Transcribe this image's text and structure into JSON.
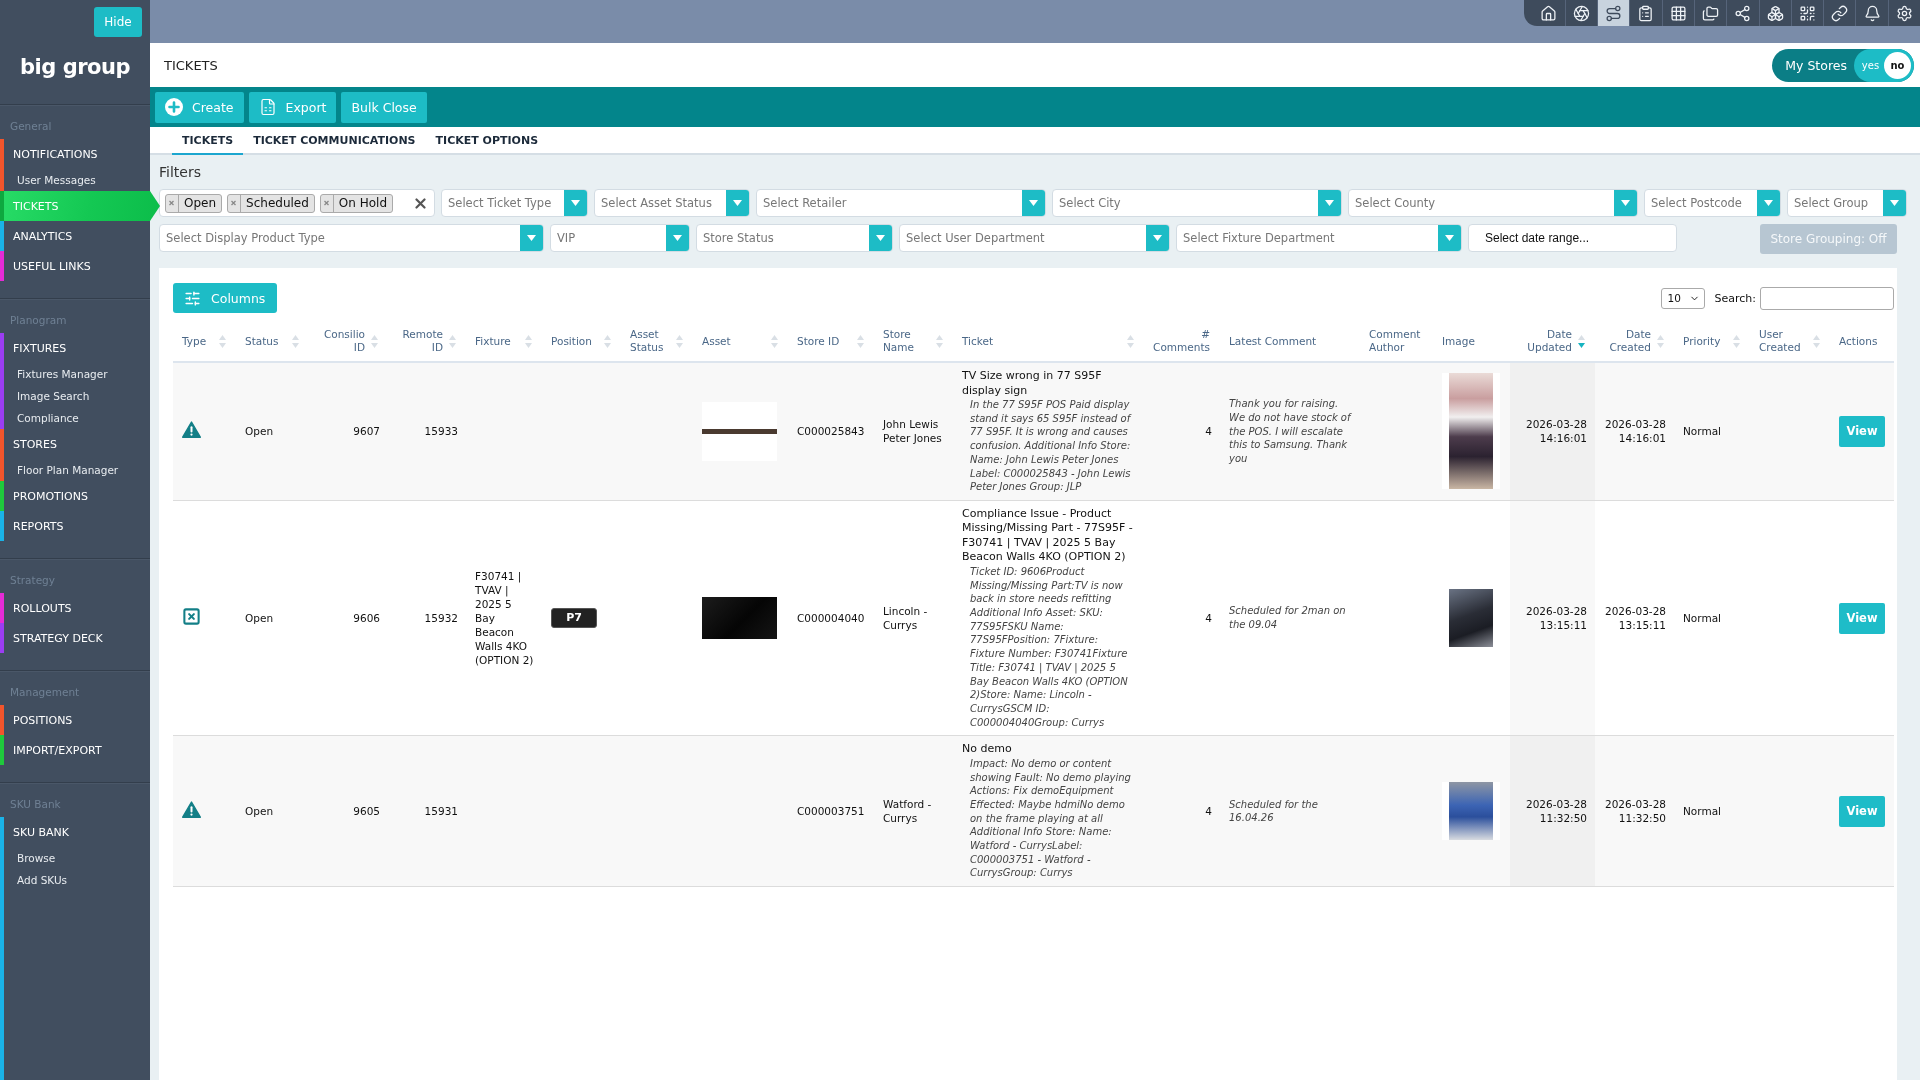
{
  "sidebar": {
    "hide_button": "Hide",
    "logo": "big group",
    "sections": [
      {
        "title": "General",
        "items": [
          {
            "label": "NOTIFICATIONS",
            "color": "#f2552c",
            "selected": false,
            "children": [
              {
                "label": "User Messages",
                "selected": false
              }
            ]
          },
          {
            "label": "TICKETS",
            "color": "#0ea83f",
            "selected": true
          },
          {
            "label": "ANALYTICS",
            "color": "#1ab3e8",
            "selected": false
          },
          {
            "label": "USEFUL LINKS",
            "color": "#e52bd6",
            "selected": false
          }
        ]
      },
      {
        "title": "Planogram",
        "items": [
          {
            "label": "FIXTURES",
            "color": "#9b3df2",
            "selected": false,
            "children": [
              {
                "label": "Fixtures Manager",
                "selected": false
              },
              {
                "label": "Image Search",
                "selected": false
              },
              {
                "label": "Compliance",
                "selected": false
              }
            ]
          },
          {
            "label": "STORES",
            "color": "#f2552c",
            "selected": false,
            "children": [
              {
                "label": "Floor Plan Manager",
                "selected": false
              }
            ]
          },
          {
            "label": "PROMOTIONS",
            "color": "#1fc93c",
            "selected": false
          },
          {
            "label": "REPORTS",
            "color": "#1ab3e8",
            "selected": false
          }
        ]
      },
      {
        "title": "Strategy",
        "items": [
          {
            "label": "ROLLOUTS",
            "color": "#e52bd6",
            "selected": false
          },
          {
            "label": "STRATEGY DECK",
            "color": "#9b3df2",
            "selected": false
          }
        ]
      },
      {
        "title": "Management",
        "items": [
          {
            "label": "POSITIONS",
            "color": "#f2552c",
            "selected": false
          },
          {
            "label": "IMPORT/EXPORT",
            "color": "#1fc93c",
            "selected": false
          }
        ]
      },
      {
        "title": "SKU Bank",
        "items": [
          {
            "label": "SKU BANK",
            "color": "#1ab3e8",
            "selected": false,
            "children": [
              {
                "label": "Browse",
                "selected": false
              },
              {
                "label": "Add SKUs",
                "selected": false
              }
            ]
          }
        ]
      }
    ]
  },
  "toolbar_icons": [
    {
      "selected": false
    },
    {
      "selected": false
    },
    {
      "selected": true
    },
    {
      "selected": false
    },
    {
      "selected": false
    },
    {
      "selected": false
    },
    {
      "selected": false
    },
    {
      "selected": false
    },
    {
      "selected": false
    },
    {
      "selected": false
    },
    {
      "selected": false
    },
    {
      "selected": false
    }
  ],
  "header": {
    "title": "TICKETS",
    "my_stores": {
      "label": "My Stores",
      "options": [
        {
          "label": "yes",
          "selected": false
        },
        {
          "label": "no",
          "selected": true
        }
      ]
    }
  },
  "actions": [
    {
      "kind": "create",
      "label": "Create"
    },
    {
      "kind": "export",
      "label": "Export"
    },
    {
      "kind": "plain",
      "label": "Bulk Close"
    }
  ],
  "tabs": [
    {
      "label": "TICKETS",
      "selected": true
    },
    {
      "label": "TICKET COMMUNICATIONS",
      "selected": false
    },
    {
      "label": "TICKET OPTIONS",
      "selected": false
    }
  ],
  "filters": {
    "title": "Filters",
    "rows": [
      {
        "items": [
          {
            "kind": "tags",
            "tags": [
              "Open",
              "Scheduled",
              "On Hold"
            ]
          },
          {
            "kind": "dropdown",
            "placeholder": "Select Ticket Type"
          },
          {
            "kind": "dropdown",
            "placeholder": "Select Asset Status"
          },
          {
            "kind": "dropdown",
            "placeholder": "Select Retailer"
          },
          {
            "kind": "dropdown",
            "placeholder": "Select City"
          },
          {
            "kind": "dropdown",
            "placeholder": "Select County"
          },
          {
            "kind": "dropdown",
            "placeholder": "Select Postcode"
          },
          {
            "kind": "dropdown",
            "placeholder": "Select Group"
          }
        ]
      },
      {
        "items": [
          {
            "kind": "dropdown",
            "placeholder": "Select Display Product Type"
          },
          {
            "kind": "dropdown",
            "placeholder": "VIP"
          },
          {
            "kind": "dropdown",
            "placeholder": "Store Status"
          },
          {
            "kind": "dropdown",
            "placeholder": "Select User Department"
          },
          {
            "kind": "dropdown",
            "placeholder": "Select Fixture Department"
          },
          {
            "kind": "date",
            "placeholder": "Select date range..."
          },
          {
            "kind": "button",
            "label": "Store Grouping: Off"
          }
        ]
      }
    ]
  },
  "table": {
    "columns_button": "Columns",
    "page_length": "10",
    "search_label": "Search:",
    "columns": [
      {
        "label": "Type",
        "sortable": true,
        "sorted": false
      },
      {
        "label": "Status",
        "sortable": true,
        "sorted": false
      },
      {
        "label": "Consilio ID",
        "sortable": true,
        "sorted": false
      },
      {
        "label": "Remote ID",
        "sortable": true,
        "sorted": false
      },
      {
        "label": "Fixture",
        "sortable": true,
        "sorted": false
      },
      {
        "label": "Position",
        "sortable": true,
        "sorted": false
      },
      {
        "label": "Asset Status",
        "sortable": true,
        "sorted": false
      },
      {
        "label": "Asset",
        "sortable": true,
        "sorted": false
      },
      {
        "label": "Store ID",
        "sortable": true,
        "sorted": false
      },
      {
        "label": "Store Name",
        "sortable": true,
        "sorted": false
      },
      {
        "label": "Ticket",
        "sortable": true,
        "sorted": false
      },
      {
        "label": "# Comments",
        "sortable": false,
        "sorted": false
      },
      {
        "label": "Latest Comment",
        "sortable": false,
        "sorted": false
      },
      {
        "label": "Comment Author",
        "sortable": false,
        "sorted": false
      },
      {
        "label": "Image",
        "sortable": false,
        "sorted": false
      },
      {
        "label": "Date Updated",
        "sortable": true,
        "sorted": true
      },
      {
        "label": "Date Created",
        "sortable": true,
        "sorted": false
      },
      {
        "label": "Priority",
        "sortable": true,
        "sorted": false
      },
      {
        "label": "User Created",
        "sortable": true,
        "sorted": false
      },
      {
        "label": "Actions",
        "sortable": false,
        "sorted": false
      }
    ],
    "rows": [
      {
        "kind": "warning",
        "status": "Open",
        "consilio_id": "9607",
        "remote_id": "15933",
        "asset_photo": {
          "kind": "banner"
        },
        "store_id": "C000025843",
        "store_name": "John Lewis Peter Jones",
        "ticket_title": "TV Size wrong in 77 S95F display sign",
        "ticket_details": "In the 77 S95F POS Paid display stand it says 65 S95F instead of 77 S95F. It is wrong and causes confusion. Additional Info Store: Name: John Lewis Peter Jones Label: C000025843 - John Lewis Peter Jones Group: JLP",
        "comments": "4",
        "latest_comment": "Thank you for raising. We do not have stock of the POS. I will escalate this to Samsung. Thank you",
        "image": {
          "kind": "portrait"
        },
        "date_updated": "2026-03-28 14:16:01",
        "date_created": "2026-03-28 14:16:01",
        "priority": "Normal",
        "action": "View"
      },
      {
        "kind": "cross",
        "status": "Open",
        "consilio_id": "9606",
        "remote_id": "15932",
        "fixture": "F30741 | TVAV | 2025 5 Bay Beacon Walls 4KO (OPTION 2)",
        "position": "P7",
        "asset_photo": {
          "kind": "screen"
        },
        "store_id": "C000004040",
        "store_name": "Lincoln - Currys",
        "ticket_title": "Compliance Issue - Product Missing/Missing Part - 77S95F - F30741 | TVAV | 2025 5 Bay Beacon Walls 4KO (OPTION 2)",
        "ticket_details": "Ticket ID: 9606Product Missing/Missing Part:TV is now back in store needs refitting Additional Info Asset: SKU: 77S95FSKU Name: 77S95FPosition: 7Fixture: Fixture Number: F30741Fixture Title: F30741 | TVAV | 2025 5 Bay Beacon Walls 4KO (OPTION 2)Store: Name: Lincoln - CurrysGSCM ID: C000004040Group: Currys",
        "comments": "4",
        "latest_comment": "Scheduled for 2man on the 09.04",
        "image": {
          "kind": "landscape"
        },
        "date_updated": "2026-03-28 13:15:11",
        "date_created": "2026-03-28 13:15:11",
        "priority": "Normal",
        "action": "View"
      },
      {
        "kind": "warning",
        "status": "Open",
        "consilio_id": "9605",
        "remote_id": "15931",
        "store_id": "C000003751",
        "store_name": "Watford - Currys",
        "ticket_title": "No demo",
        "ticket_details": "Impact: No demo or content showing Fault: No demo playing Actions: Fix demoEquipment Effected: Maybe hdmiNo demo on the frame playing at all Additional Info Store: Name: Watford - CurrysLabel: C000003751 - Watford - CurrysGroup: Currys",
        "comments": "4",
        "latest_comment": "Scheduled for the 16.04.26",
        "image": {
          "kind": "display"
        },
        "date_updated": "2026-03-28 11:32:50",
        "date_created": "2026-03-28 11:32:50",
        "priority": "Normal",
        "action": "View"
      }
    ]
  }
}
